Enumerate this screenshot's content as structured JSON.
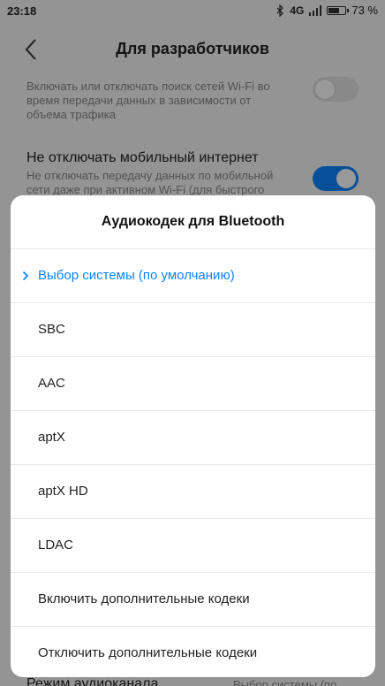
{
  "status_bar": {
    "time": "23:18",
    "network": "4G",
    "battery_percent": "73 %",
    "battery_level": 0.73,
    "icons": [
      "bluetooth-icon",
      "signal-icon",
      "battery-icon"
    ]
  },
  "header": {
    "title": "Для разработчиков",
    "back_icon": "chevron-left-icon"
  },
  "background_settings": [
    {
      "title": "",
      "description": "Включать или отключать поиск сетей Wi-Fi во время передачи данных в зависимости от объема трафика",
      "toggle": false
    },
    {
      "title": "Не отключать мобильный интернет",
      "description": "Не отключать передачу данных по мобильной сети даже при активном Wi-Fi (для быстрого",
      "toggle": true
    }
  ],
  "bottom_setting": {
    "label": "Режим аудиоканала",
    "value": "Выбор системы (по"
  },
  "dialog": {
    "title": "Аудиокодек для Bluetooth",
    "options": [
      {
        "label": "Выбор системы (по умолчанию)",
        "selected": true
      },
      {
        "label": "SBC",
        "selected": false
      },
      {
        "label": "AAC",
        "selected": false
      },
      {
        "label": "aptX",
        "selected": false
      },
      {
        "label": "aptX HD",
        "selected": false
      },
      {
        "label": "LDAC",
        "selected": false
      },
      {
        "label": "Включить дополнительные кодеки",
        "selected": false
      },
      {
        "label": "Отключить дополнительные кодеки",
        "selected": false
      }
    ]
  },
  "colors": {
    "accent": "#0d84ff",
    "scrim": "rgba(0,0,0,0.4)",
    "background": "#f7f7f7"
  }
}
